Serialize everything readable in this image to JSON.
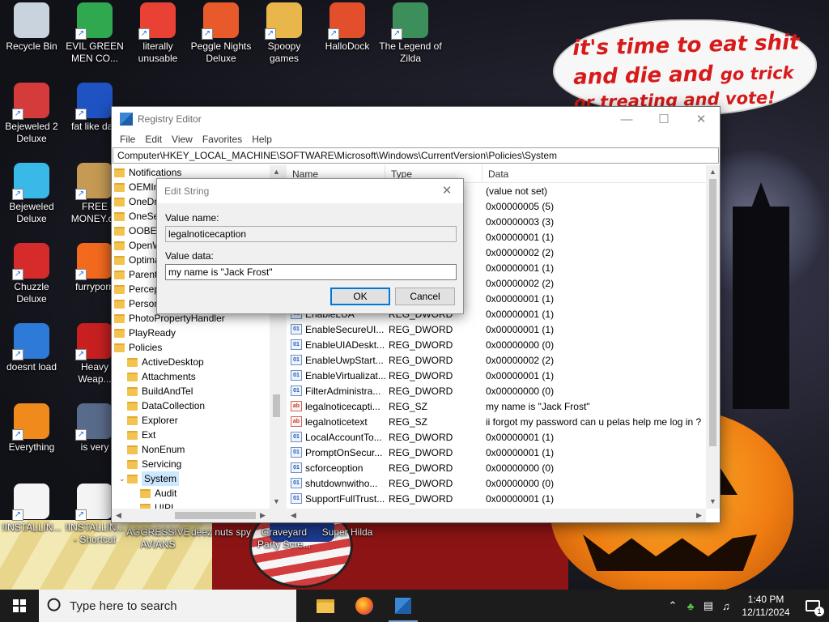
{
  "wallpaper": {
    "bubble_line1": "it's time to eat shit",
    "bubble_line2a": "and die and ",
    "bubble_line2b": "go trick",
    "bubble_line3": "or treating and vote!"
  },
  "desktop_icons": [
    {
      "label": "Recycle Bin",
      "icon": "recycle-bin-icon",
      "color": "#c9d3de"
    },
    {
      "label": "EVIL GREEN MEN CO...",
      "icon": "green-men-icon",
      "color": "#2fa84f"
    },
    {
      "label": "literally unusable",
      "icon": "chrome-icon",
      "color": "#e94235"
    },
    {
      "label": "Peggle Nights Deluxe",
      "icon": "peggle-icon",
      "color": "#e85a2a"
    },
    {
      "label": "Spoopy games",
      "icon": "folder-icon",
      "color": "#e9b64b"
    },
    {
      "label": "HalloDock",
      "icon": "windows-flag-icon",
      "color": "#e24f2a"
    },
    {
      "label": "The Legend of Zilda",
      "icon": "zilda-icon",
      "color": "#3c8f5a"
    },
    {
      "label": "Bejeweled 2 Deluxe",
      "icon": "bejeweled-2-icon",
      "color": "#d63b3b"
    },
    {
      "label": "fat like darl",
      "icon": "mpl-icon",
      "color": "#1f53c4"
    },
    {
      "label": "Bejeweled Deluxe",
      "icon": "diamond-icon",
      "color": "#38b9e8"
    },
    {
      "label": "FREE MONEY.co",
      "icon": "money-bag-icon",
      "color": "#c59a54"
    },
    {
      "label": "Chuzzle Deluxe",
      "icon": "chuzzle-icon",
      "color": "#d52b2b"
    },
    {
      "label": "furryporn",
      "icon": "firefox-icon",
      "color": "#f36a1e"
    },
    {
      "label": "doesnt load",
      "icon": "thunderbird-icon",
      "color": "#2e7ad8"
    },
    {
      "label": "Heavy Weap...",
      "icon": "radiation-icon",
      "color": "#c82020"
    },
    {
      "label": "Everything",
      "icon": "everything-search-icon",
      "color": "#f08a1c"
    },
    {
      "label": "is very",
      "icon": "shield-logo-icon",
      "color": "#596b8a"
    },
    {
      "label": "!INSTALLIN...",
      "icon": "text-file-icon",
      "color": "#f4f4f4"
    },
    {
      "label": "!INSTALLIN... - Shortcut",
      "icon": "text-file-icon",
      "color": "#f4f4f4"
    },
    {
      "label": "AGGRESSIVE AVIANS",
      "icon": "",
      "color": ""
    },
    {
      "label": "deez nuts spy",
      "icon": "",
      "color": ""
    },
    {
      "label": "Graveyard Party Scre...",
      "icon": "",
      "color": ""
    },
    {
      "label": "Super Hilda",
      "icon": "",
      "color": ""
    }
  ],
  "regedit": {
    "title": "Registry Editor",
    "menu": [
      "File",
      "Edit",
      "View",
      "Favorites",
      "Help"
    ],
    "address": "Computer\\HKEY_LOCAL_MACHINE\\SOFTWARE\\Microsoft\\Windows\\CurrentVersion\\Policies\\System",
    "tree": [
      {
        "label": "Notifications",
        "level": 0
      },
      {
        "label": "OEMInf",
        "level": 0
      },
      {
        "label": "OneDriv",
        "level": 0
      },
      {
        "label": "OneSett",
        "level": 0
      },
      {
        "label": "OOBE",
        "level": 0
      },
      {
        "label": "OpenW",
        "level": 0
      },
      {
        "label": "Optima",
        "level": 0
      },
      {
        "label": "Parenta",
        "level": 0
      },
      {
        "label": "Percept",
        "level": 0
      },
      {
        "label": "Persona",
        "level": 0
      },
      {
        "label": "PhotoPropertyHandler",
        "level": 0
      },
      {
        "label": "PlayReady",
        "level": 0
      },
      {
        "label": "Policies",
        "level": 0
      },
      {
        "label": "ActiveDesktop",
        "level": 1
      },
      {
        "label": "Attachments",
        "level": 1
      },
      {
        "label": "BuildAndTel",
        "level": 1
      },
      {
        "label": "DataCollection",
        "level": 1
      },
      {
        "label": "Explorer",
        "level": 1
      },
      {
        "label": "Ext",
        "level": 1
      },
      {
        "label": "NonEnum",
        "level": 1
      },
      {
        "label": "Servicing",
        "level": 1
      },
      {
        "label": "System",
        "level": 1,
        "selected": true
      },
      {
        "label": "Audit",
        "level": 2
      },
      {
        "label": "UIPI",
        "level": 2
      }
    ],
    "columns": {
      "name": "Name",
      "type": "Type",
      "data": "Data"
    },
    "values": [
      {
        "name": "",
        "type": "",
        "data": "(value not set)",
        "kind": "sz"
      },
      {
        "name": "",
        "type": "",
        "data": "0x00000005 (5)",
        "kind": "dw"
      },
      {
        "name": "",
        "type": "",
        "data": "0x00000003 (3)",
        "kind": "dw"
      },
      {
        "name": "",
        "type": "",
        "data": "0x00000001 (1)",
        "kind": "dw"
      },
      {
        "name": "",
        "type": "",
        "data": "0x00000002 (2)",
        "kind": "dw"
      },
      {
        "name": "",
        "type": "",
        "data": "0x00000001 (1)",
        "kind": "dw"
      },
      {
        "name": "",
        "type": "",
        "data": "0x00000002 (2)",
        "kind": "dw"
      },
      {
        "name": "",
        "type": "",
        "data": "0x00000001 (1)",
        "kind": "dw"
      },
      {
        "name": "EnableLUA",
        "type": "REG_DWORD",
        "data": "0x00000001 (1)",
        "kind": "dw"
      },
      {
        "name": "EnableSecureUI...",
        "type": "REG_DWORD",
        "data": "0x00000001 (1)",
        "kind": "dw"
      },
      {
        "name": "EnableUIADeskt...",
        "type": "REG_DWORD",
        "data": "0x00000000 (0)",
        "kind": "dw"
      },
      {
        "name": "EnableUwpStart...",
        "type": "REG_DWORD",
        "data": "0x00000002 (2)",
        "kind": "dw"
      },
      {
        "name": "EnableVirtualizat...",
        "type": "REG_DWORD",
        "data": "0x00000001 (1)",
        "kind": "dw"
      },
      {
        "name": "FilterAdministra...",
        "type": "REG_DWORD",
        "data": "0x00000000 (0)",
        "kind": "dw"
      },
      {
        "name": "legalnoticecapti...",
        "type": "REG_SZ",
        "data": "my name is \"Jack Frost\"",
        "kind": "sz"
      },
      {
        "name": "legalnoticetext",
        "type": "REG_SZ",
        "data": "ii forgot my password can u pelas help me log in ?",
        "kind": "sz"
      },
      {
        "name": "LocalAccountTo...",
        "type": "REG_DWORD",
        "data": "0x00000001 (1)",
        "kind": "dw"
      },
      {
        "name": "PromptOnSecur...",
        "type": "REG_DWORD",
        "data": "0x00000001 (1)",
        "kind": "dw"
      },
      {
        "name": "scforceoption",
        "type": "REG_DWORD",
        "data": "0x00000000 (0)",
        "kind": "dw"
      },
      {
        "name": "shutdownwitho...",
        "type": "REG_DWORD",
        "data": "0x00000000 (0)",
        "kind": "dw"
      },
      {
        "name": "SupportFullTrust...",
        "type": "REG_DWORD",
        "data": "0x00000001 (1)",
        "kind": "dw"
      }
    ]
  },
  "dialog": {
    "title": "Edit String",
    "value_name_label": "Value name:",
    "value_name": "legalnoticecaption",
    "value_data_label": "Value data:",
    "value_data": "my name is \"Jack Frost\"",
    "ok_label": "OK",
    "cancel_label": "Cancel"
  },
  "taskbar": {
    "search_placeholder": "Type here to search",
    "time": "1:40 PM",
    "date": "12/11/2024",
    "notification_count": "1"
  }
}
